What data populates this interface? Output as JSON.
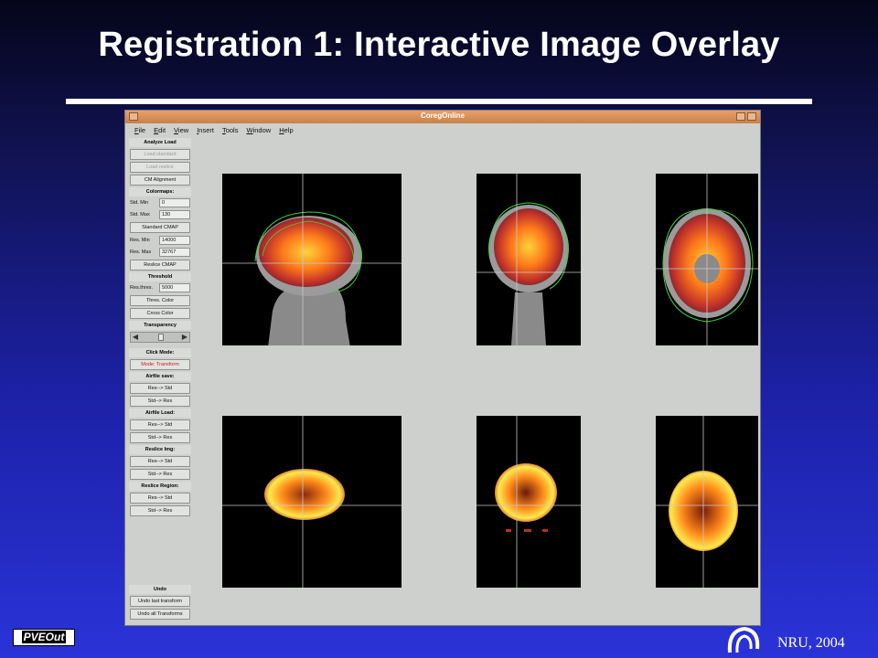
{
  "slide": {
    "title": "Registration 1: Interactive Image Overlay",
    "footer_logo": "PVEOut",
    "credit": "NRU, 2004"
  },
  "window": {
    "title": "CoregOnline",
    "menus": [
      "File",
      "Edit",
      "View",
      "Insert",
      "Tools",
      "Window",
      "Help"
    ]
  },
  "panel": {
    "analyze_load": "Analyze Load",
    "load_standard": "Load standard",
    "load_reslice": "Load reslice",
    "cm_alignment": "CM Alignment",
    "colormaps": "Colormaps:",
    "std_min_label": "Std. Min",
    "std_min_value": "0",
    "std_max_label": "Std. Max",
    "std_max_value": "130",
    "standard_cmap": "Standard CMAP",
    "res_min_label": "Res. Min",
    "res_min_value": "14000",
    "res_max_label": "Res. Max",
    "res_max_value": "32767",
    "reslice_cmap": "Reslice CMAP",
    "threshold": "Threshold",
    "res_thres_label": "Res.thres.",
    "res_thres_value": "5000",
    "thres_color": "Thres. Color",
    "cross_color": "Cross Color",
    "transparency": "Transparency",
    "click_mode": "Click Mode:",
    "mode_transform": "Mode: Transform",
    "airfile_save": "Airfile save:",
    "res_to_std": "Res--> Std",
    "std_to_res": "Std--> Res",
    "airfile_load": "Airfile Load:",
    "reslice_img": "Reslice Img:",
    "reslice_region": "Reslice Region:",
    "undo": "Undo",
    "undo_last": "Undo last transform",
    "undo_all": "Undo all Transforms"
  },
  "colors": {
    "overlay_outline": "#3fd23f",
    "crosshair": "#c8c8c8",
    "pet_hot": "#ff8a1a",
    "pet_core": "#ffe94d"
  }
}
